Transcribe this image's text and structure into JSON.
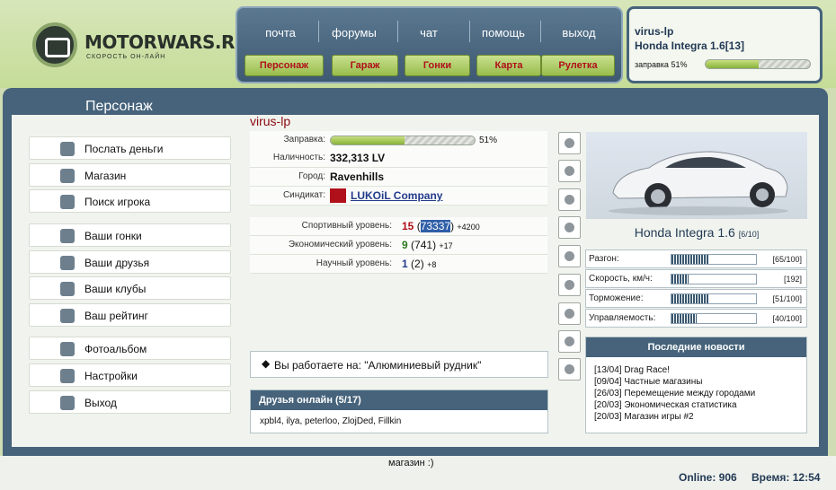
{
  "logo": {
    "name": "MOTORWARS.RU",
    "sub": "СКОРОСТЬ ОН-ЛАЙН"
  },
  "topnav": {
    "links": [
      "почта",
      "форумы",
      "чат",
      "помощь",
      "выход"
    ],
    "buttons": [
      "Персонаж",
      "Гараж",
      "Гонки",
      "Карта",
      "Рулетка"
    ]
  },
  "user": {
    "name": "virus-lp",
    "car": "Honda Integra 1.6[13]",
    "fuel_label": "заправка 51%",
    "fuel_pct": 51
  },
  "panel": {
    "title": "Персонаж"
  },
  "sidebar": {
    "items": [
      "Послать деньги",
      "Магазин",
      "Поиск игрока",
      "Ваши гонки",
      "Ваши друзья",
      "Ваши клубы",
      "Ваш рейтинг",
      "Фотоальбом",
      "Настройки",
      "Выход"
    ]
  },
  "character": {
    "name": "virus-lp",
    "fuel_label": "Заправка:",
    "fuel_value": "51%",
    "fuel_pct": 51,
    "cash_label": "Наличность:",
    "cash": "332,313 LV",
    "city_label": "Город:",
    "city": "Ravenhills",
    "syndicate_label": "Синдикат:",
    "syndicate": "LUKOiL Company",
    "levels": [
      {
        "label": "Спортивный уровень:",
        "level": "15",
        "open": "(",
        "points": "73337",
        "close": ")",
        "bonus": "+4200",
        "color": "#b0101a"
      },
      {
        "label": "Экономический уровень:",
        "level": "9",
        "open": "(",
        "points": "741",
        "close": ")",
        "bonus": "+17",
        "color": "#2b7a1d"
      },
      {
        "label": "Научный уровень:",
        "level": "1",
        "open": "(",
        "points": "2",
        "close": ")",
        "bonus": "+8",
        "color": "#223a8a"
      }
    ],
    "job": "Вы работаете на: \"Алюминиевый рудник\""
  },
  "friends": {
    "title": "Друзья онлайн (5/17)",
    "list": "xpbl4, ilya, peterloo, ZlojDed, Fillkin"
  },
  "car": {
    "name": "Honda Integra 1.6",
    "rank": "[6/10]",
    "stats": [
      {
        "label": "Разгон:",
        "value": "[65/100]",
        "pct": 0.45
      },
      {
        "label": "Скорость, км/ч:",
        "value": "[192]",
        "pct": 0.2
      },
      {
        "label": "Торможение:",
        "value": "[51/100]",
        "pct": 0.44
      },
      {
        "label": "Управляемость:",
        "value": "[40/100]",
        "pct": 0.3
      }
    ]
  },
  "news": {
    "title": "Последние новости",
    "items": [
      "[13/04] Drag Race!",
      "[09/04] Частные магазины",
      "[26/03] Перемещение между городами",
      "[20/03] Экономическая статистика",
      "[20/03] Магазин игры #2"
    ]
  },
  "footer": {
    "status": "магазин :)",
    "online": "Online: 906",
    "time": "Время: 12:54"
  }
}
